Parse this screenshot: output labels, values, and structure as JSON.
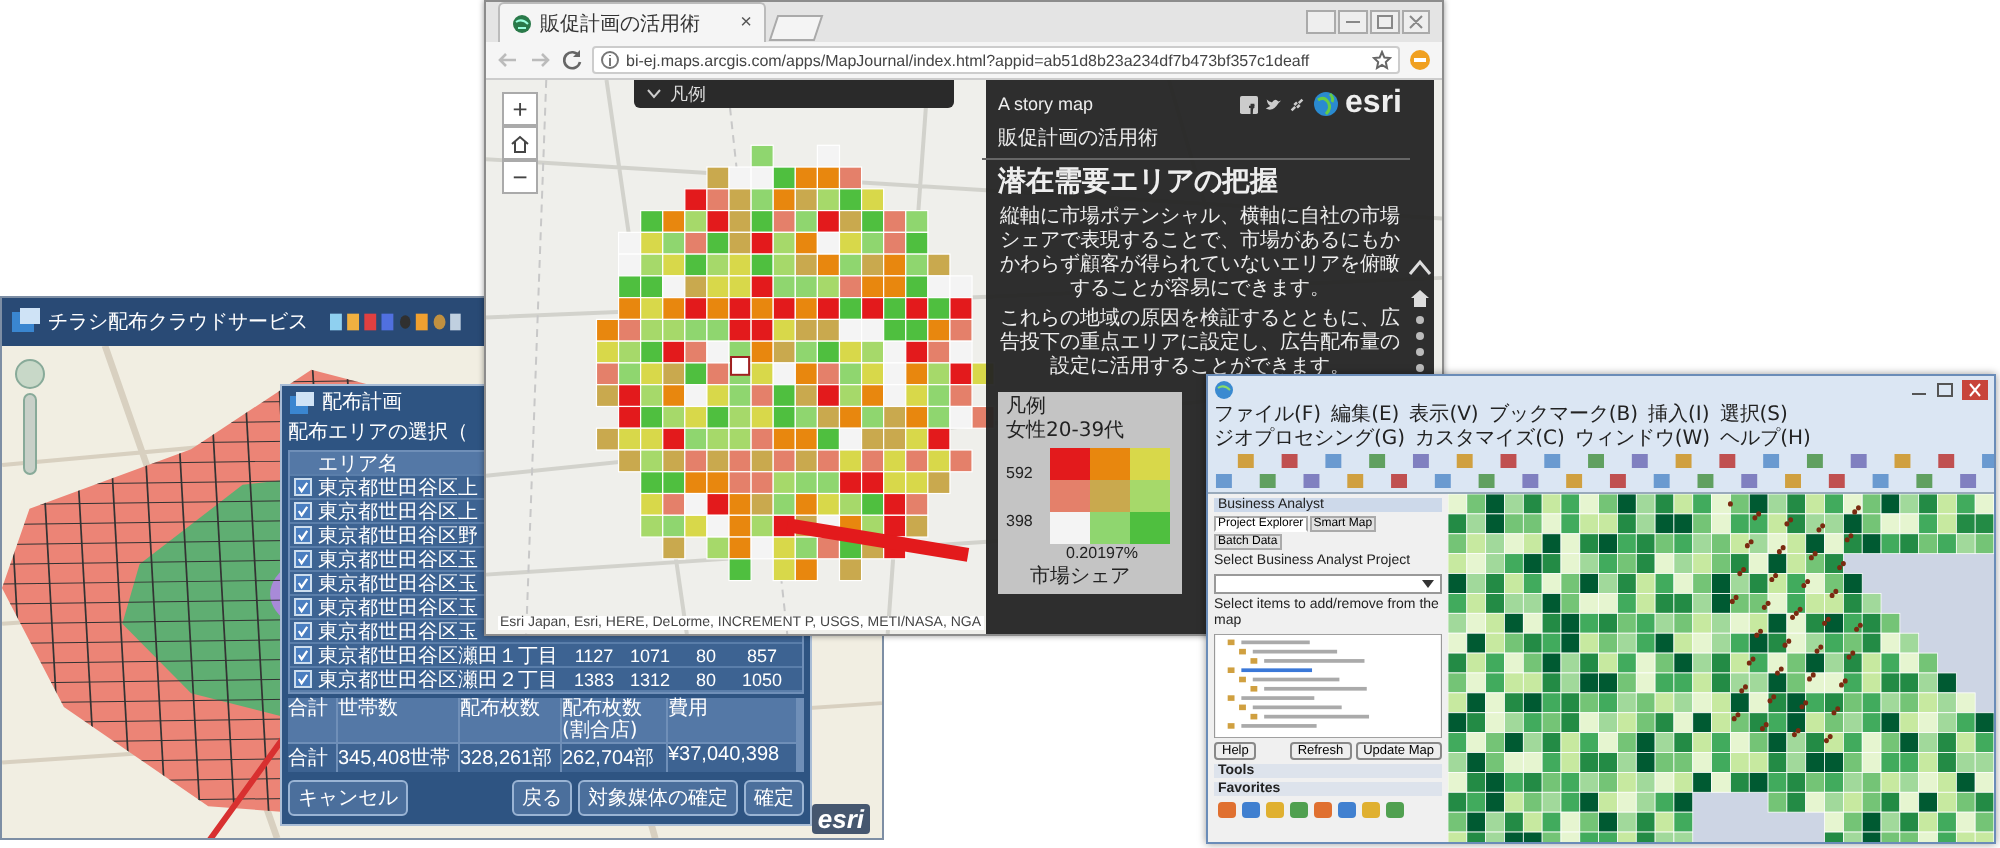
{
  "left_window": {
    "title": "チラシ配布クラウドサービス",
    "logo": "esri"
  },
  "distribution_dialog": {
    "title": "配布計画",
    "instruction": "配布エリアの選択（",
    "columns": [
      "エリア名"
    ],
    "rows": [
      {
        "checked": true,
        "name": "東京都世田谷区上",
        "cells": []
      },
      {
        "checked": true,
        "name": "東京都世田谷区上",
        "cells": []
      },
      {
        "checked": true,
        "name": "東京都世田谷区野",
        "cells": []
      },
      {
        "checked": true,
        "name": "東京都世田谷区玉",
        "cells": []
      },
      {
        "checked": true,
        "name": "東京都世田谷区玉",
        "cells": []
      },
      {
        "checked": true,
        "name": "東京都世田谷区玉",
        "cells": []
      },
      {
        "checked": true,
        "name": "東京都世田谷区玉",
        "cells": []
      },
      {
        "checked": true,
        "name": "東京都世田谷区瀬田１丁目",
        "cells": [
          "1127",
          "1071",
          "80",
          "857"
        ]
      },
      {
        "checked": true,
        "name": "東京都世田谷区瀬田２丁目",
        "cells": [
          "1383",
          "1312",
          "80",
          "1050"
        ]
      }
    ],
    "summary_columns": [
      "合計",
      "世帯数",
      "配布枚数",
      "配布枚数(割合店)",
      "費用"
    ],
    "summary_values": [
      "合計",
      "345,408世帯",
      "328,261部",
      "262,704部",
      "¥37,040,398"
    ],
    "buttons_left": [
      "キャンセル"
    ],
    "buttons_right": [
      "戻る",
      "対象媒体の確定",
      "確定"
    ]
  },
  "browser": {
    "tab_title": "販促計画の活用術",
    "tab_close": "×",
    "url": "bi-ej.maps.arcgis.com/apps/MapJournal/index.html?appid=ab51d8b23a234df7b473bf357c1deaff",
    "map_controls": [
      "+",
      "−"
    ],
    "legend_toggle": "凡例",
    "attribution": "Esri Japan, Esri, HERE, DeLorme, INCREMENT P, USGS, METI/NASA, NGA"
  },
  "story_panel": {
    "kicker": "A story map",
    "logo": "esri",
    "series_title": "販促計画の活用術",
    "heading": "潜在需要エリアの把握",
    "paragraphs": [
      "縦軸に市場ポテンシャル、横軸に自社の市場シェアで表現することで、市場があるにもかかわらず顧客が得られていないエリアを俯瞰することが容易にできます。",
      "これらの地域の原因を検証するとともに、広告投下の重点エリアに設定し、広告配布量の設定に活用することができます。"
    ],
    "legend": {
      "title": "凡例",
      "subtitle": "女性20-39代",
      "y_labels": [
        "592",
        "398"
      ],
      "x_label": "0.20197%",
      "axis_title": "市場シェア",
      "cells": [
        {
          "color": "#e31a1c"
        },
        {
          "color": "#e8870e"
        },
        {
          "color": "#d8d84a"
        },
        {
          "color": "#e4806a"
        },
        {
          "color": "#c9a94e"
        },
        {
          "color": "#a6d96a"
        },
        {
          "color": "#f4f4f4"
        },
        {
          "color": "#8fd66f"
        },
        {
          "color": "#4fbf3f"
        }
      ]
    }
  },
  "arcmap_window": {
    "menus": [
      "ファイル(F)",
      "編集(E)",
      "表示(V)",
      "ブックマーク(B)",
      "挿入(I)",
      "選択(S)",
      "ジオプロセシング(G)",
      "カスタマイズ(C)",
      "ウィンドウ(W)",
      "ヘルプ(H)"
    ],
    "panel_title": "Business Analyst",
    "tabs": [
      {
        "label": "Project Explorer",
        "selected": true
      },
      {
        "label": "Smart Map",
        "selected": false
      },
      {
        "label": "Batch Data",
        "selected": false
      }
    ],
    "project_label": "Select Business Analyst Project",
    "items_label": "Select items to add/remove from the map",
    "buttons_left": [
      "Help"
    ],
    "buttons_right": [
      "Refresh",
      "Update Map"
    ],
    "sections": [
      "Tools",
      "Favorites"
    ]
  }
}
